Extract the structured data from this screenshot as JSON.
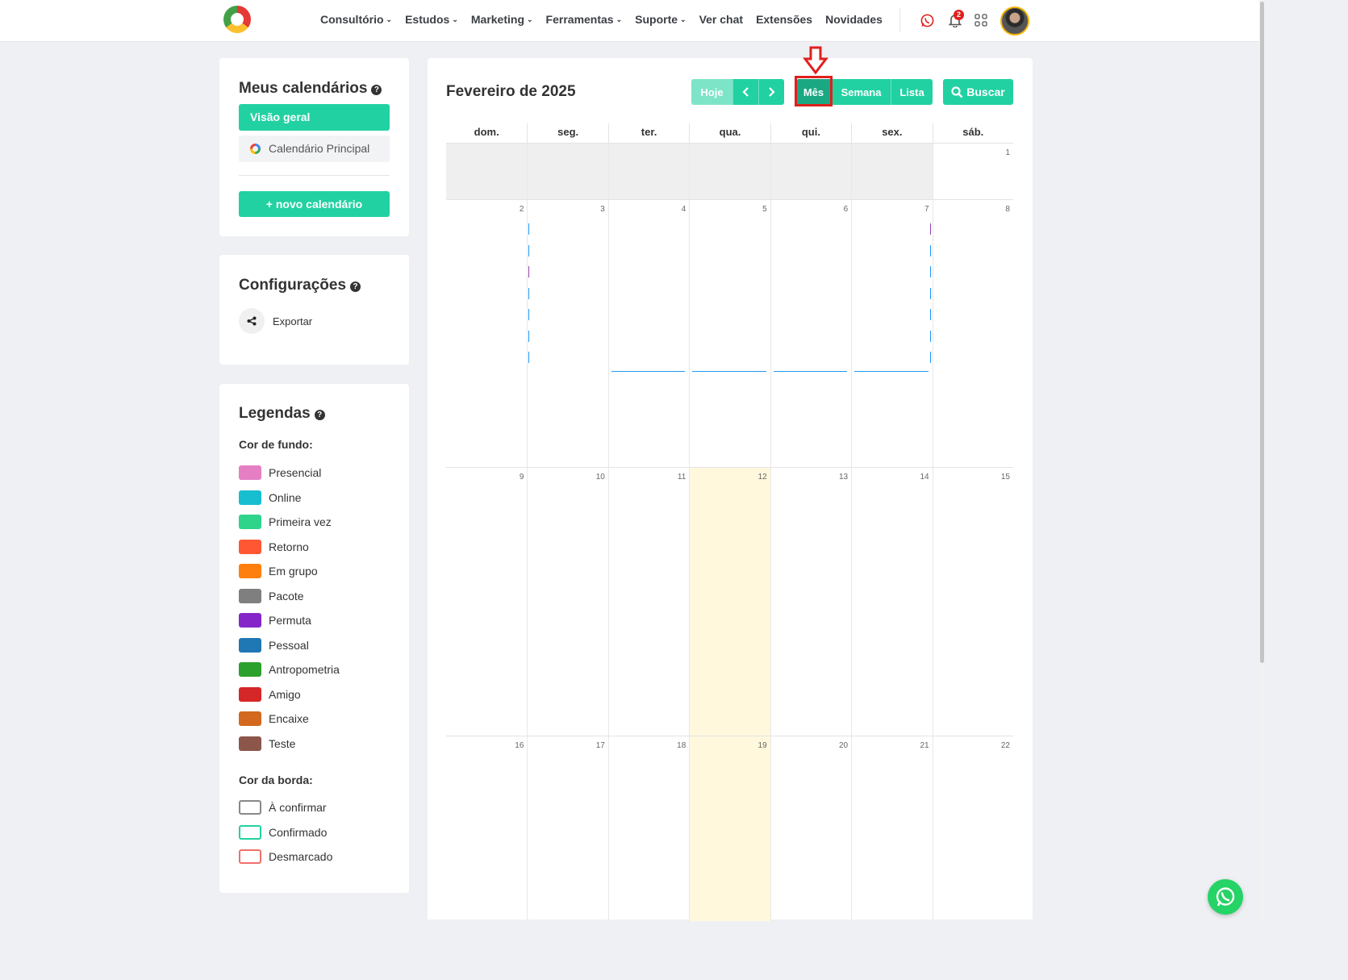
{
  "nav": {
    "menu": [
      {
        "label": "Consultório",
        "dropdown": true
      },
      {
        "label": "Estudos",
        "dropdown": true
      },
      {
        "label": "Marketing",
        "dropdown": true
      },
      {
        "label": "Ferramentas",
        "dropdown": true
      },
      {
        "label": "Suporte",
        "dropdown": true
      },
      {
        "label": "Ver chat",
        "dropdown": false
      },
      {
        "label": "Extensões",
        "dropdown": false
      },
      {
        "label": "Novidades",
        "dropdown": false
      }
    ],
    "notification_count": "2",
    "icons": [
      "whatsapp-icon",
      "bell-icon",
      "apps-grid-icon",
      "avatar"
    ]
  },
  "calendars": {
    "title": "Meus calendários",
    "overview_label": "Visão geral",
    "main_calendar_label": "Calendário Principal",
    "new_calendar_label": "+ novo calendário"
  },
  "settings": {
    "title": "Configurações",
    "export_label": "Exportar"
  },
  "legend": {
    "title": "Legendas",
    "background_heading": "Cor de fundo:",
    "background_items": [
      {
        "label": "Presencial",
        "color": "#e57fc3"
      },
      {
        "label": "Online",
        "color": "#17becf"
      },
      {
        "label": "Primeira vez",
        "color": "#2ed48a"
      },
      {
        "label": "Retorno",
        "color": "#ff5733"
      },
      {
        "label": "Em grupo",
        "color": "#ff7f0e"
      },
      {
        "label": "Pacote",
        "color": "#7f7f7f"
      },
      {
        "label": "Permuta",
        "color": "#8526c9"
      },
      {
        "label": "Pessoal",
        "color": "#1f77b4"
      },
      {
        "label": "Antropometria",
        "color": "#2ca02c"
      },
      {
        "label": "Amigo",
        "color": "#d62728"
      },
      {
        "label": "Encaixe",
        "color": "#d2691e"
      },
      {
        "label": "Teste",
        "color": "#8c564b"
      }
    ],
    "border_heading": "Cor da borda:",
    "border_items": [
      {
        "label": "À confirmar",
        "color": "#888888"
      },
      {
        "label": "Confirmado",
        "color": "#22d1a2"
      },
      {
        "label": "Desmarcado",
        "color": "#f0706a"
      }
    ]
  },
  "calendar": {
    "title": "Fevereiro de 2025",
    "today_label": "Hoje",
    "prev_icon": "chevron-left-icon",
    "next_icon": "chevron-right-icon",
    "views": [
      "Mês",
      "Semana",
      "Lista"
    ],
    "active_view": "Mês",
    "search_label": "Buscar",
    "weekdays": [
      "dom.",
      "seg.",
      "ter.",
      "qua.",
      "qui.",
      "sex.",
      "sáb."
    ],
    "weeks": [
      [
        "",
        "",
        "",
        "",
        "",
        "",
        "1"
      ],
      [
        "2",
        "3",
        "4",
        "5",
        "6",
        "7",
        "8"
      ],
      [
        "9",
        "10",
        "11",
        "12",
        "13",
        "14",
        "15"
      ],
      [
        "16",
        "17",
        "18",
        "19",
        "20",
        "21",
        "22"
      ]
    ]
  }
}
